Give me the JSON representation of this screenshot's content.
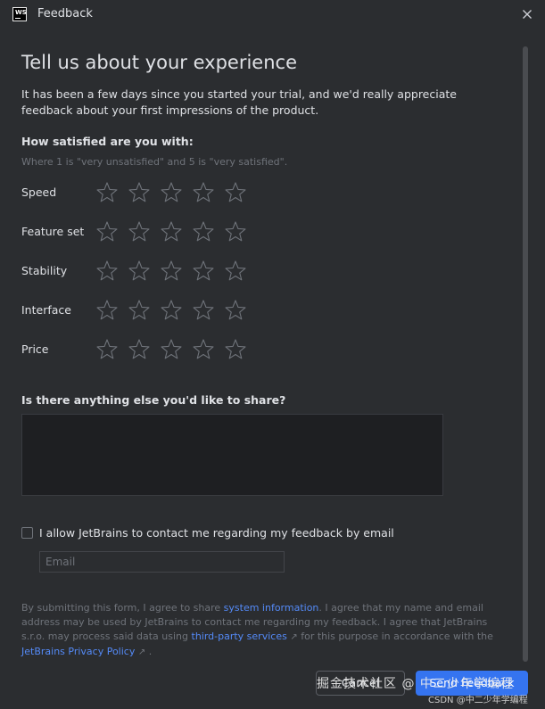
{
  "window": {
    "title": "Feedback",
    "logo_text": "WS"
  },
  "heading": "Tell us about your experience",
  "intro": "It has been a few days since you started your trial, and we'd really appreciate feedback about your first impressions of the product.",
  "satisfaction": {
    "title": "How satisfied are you with:",
    "hint": "Where 1 is \"very unsatisfied\" and 5 is \"very satisfied\".",
    "max_stars": 5,
    "categories": [
      {
        "label": "Speed",
        "rating": 0
      },
      {
        "label": "Feature set",
        "rating": 0
      },
      {
        "label": "Stability",
        "rating": 0
      },
      {
        "label": "Interface",
        "rating": 0
      },
      {
        "label": "Price",
        "rating": 0
      }
    ]
  },
  "share": {
    "title": "Is there anything else you'd like to share?",
    "value": ""
  },
  "contact": {
    "checked": false,
    "label": "I allow JetBrains to contact me regarding my feedback by email",
    "email_placeholder": "Email",
    "email_value": ""
  },
  "legal": {
    "part1": "By submitting this form, I agree to share ",
    "link1": "system information",
    "part2": ". I agree that my name and email address may be used by JetBrains to contact me regarding my feedback. I agree that JetBrains s.r.o. may process said data using ",
    "link2": "third-party services",
    "external_arrow": "↗",
    "part3": " for this purpose in accordance with the ",
    "link3": "JetBrains Privacy Policy",
    "part4": " ."
  },
  "buttons": {
    "cancel": "Cancel",
    "send": "Send Feedback"
  },
  "watermarks": {
    "line1": "掘金技术社区 @ 中二少年学编程",
    "line2": "CSDN @中二少年学编程"
  },
  "colors": {
    "background": "#2b2d30",
    "text": "#dfe1e5",
    "muted": "#6f737a",
    "link": "#548af7",
    "primary": "#3574f0",
    "star_outline": "#6f737a"
  },
  "icons": {
    "close": "close-icon",
    "star": "star-outline-icon",
    "external": "external-link-icon"
  }
}
